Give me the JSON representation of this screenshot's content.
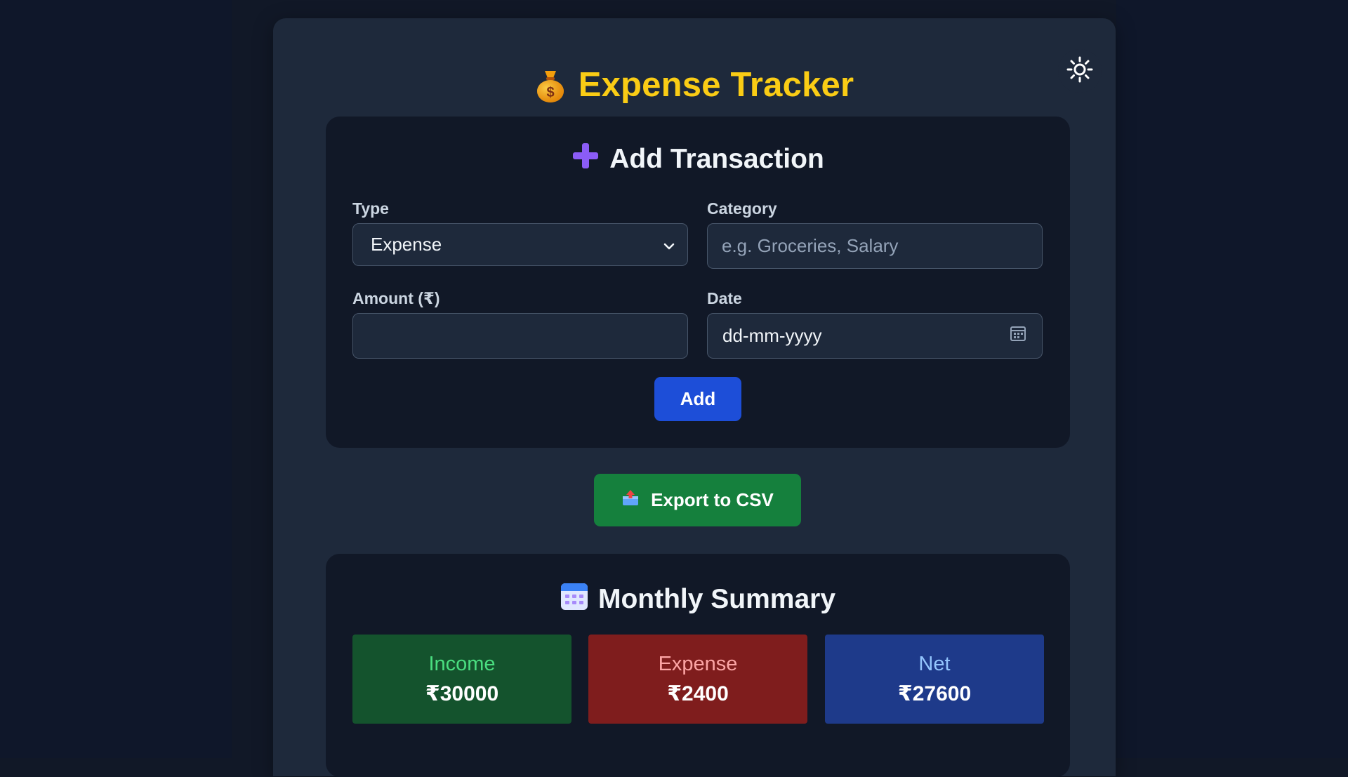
{
  "app": {
    "title": "Expense Tracker",
    "title_color": "#facc15"
  },
  "header": {
    "logo_icon": "money-bag-icon",
    "theme_toggle_icon": "sun-icon"
  },
  "add_form": {
    "title": "Add Transaction",
    "title_icon": "plus-icon",
    "type_label": "Type",
    "type_value": "Expense",
    "category_label": "Category",
    "category_placeholder": "e.g. Groceries, Salary",
    "amount_label": "Amount (₹)",
    "amount_value": "",
    "date_label": "Date",
    "date_placeholder": "dd-mm-yyyy",
    "add_button": "Add"
  },
  "export": {
    "label": "Export to CSV",
    "icon": "outbox-tray-icon",
    "color": "#15803d"
  },
  "summary": {
    "title": "Monthly Summary",
    "title_icon": "calendar-icon",
    "income_label": "Income",
    "income_value": "₹30000",
    "expense_label": "Expense",
    "expense_value": "₹2400",
    "net_label": "Net",
    "net_value": "₹27600"
  },
  "colors": {
    "income_bg": "#14532d",
    "expense_bg": "#7f1d1d",
    "net_bg": "#1e3a8a",
    "add_button": "#1d4ed8"
  }
}
